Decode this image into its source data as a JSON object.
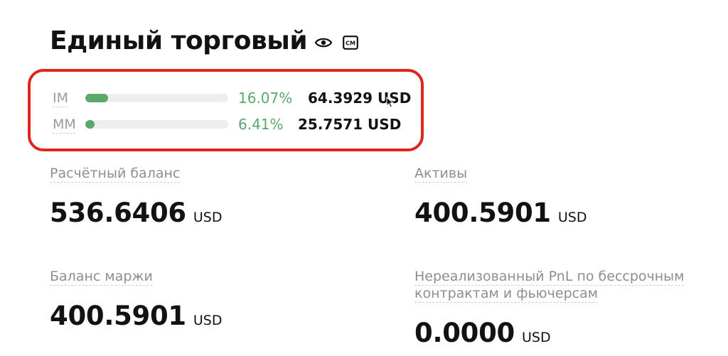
{
  "header": {
    "title": "Единый торговый",
    "icons": [
      "eye-icon",
      "cm-icon"
    ],
    "cm_label": "CM"
  },
  "margin": {
    "highlight_color": "#e0261c",
    "bar_color": "#5aa86a",
    "im": {
      "label": "IM",
      "percent": "16.07%",
      "level": 0.1607,
      "value": "64.3929 USD"
    },
    "mm": {
      "label": "MM",
      "percent": "6.41%",
      "level": 0.0641,
      "value": "25.7571 USD"
    }
  },
  "stats": {
    "settled_balance": {
      "label": "Расчётный баланс",
      "value": "536.6406",
      "unit": "USD"
    },
    "assets": {
      "label": "Активы",
      "value": "400.5901",
      "unit": "USD"
    },
    "margin_balance": {
      "label": "Баланс маржи",
      "value": "400.5901",
      "unit": "USD"
    },
    "unrealized_pnl": {
      "label": "Нереализованный PnL по бессрочным контрактам и фьючерсам",
      "value": "0.0000",
      "unit": "USD"
    }
  }
}
